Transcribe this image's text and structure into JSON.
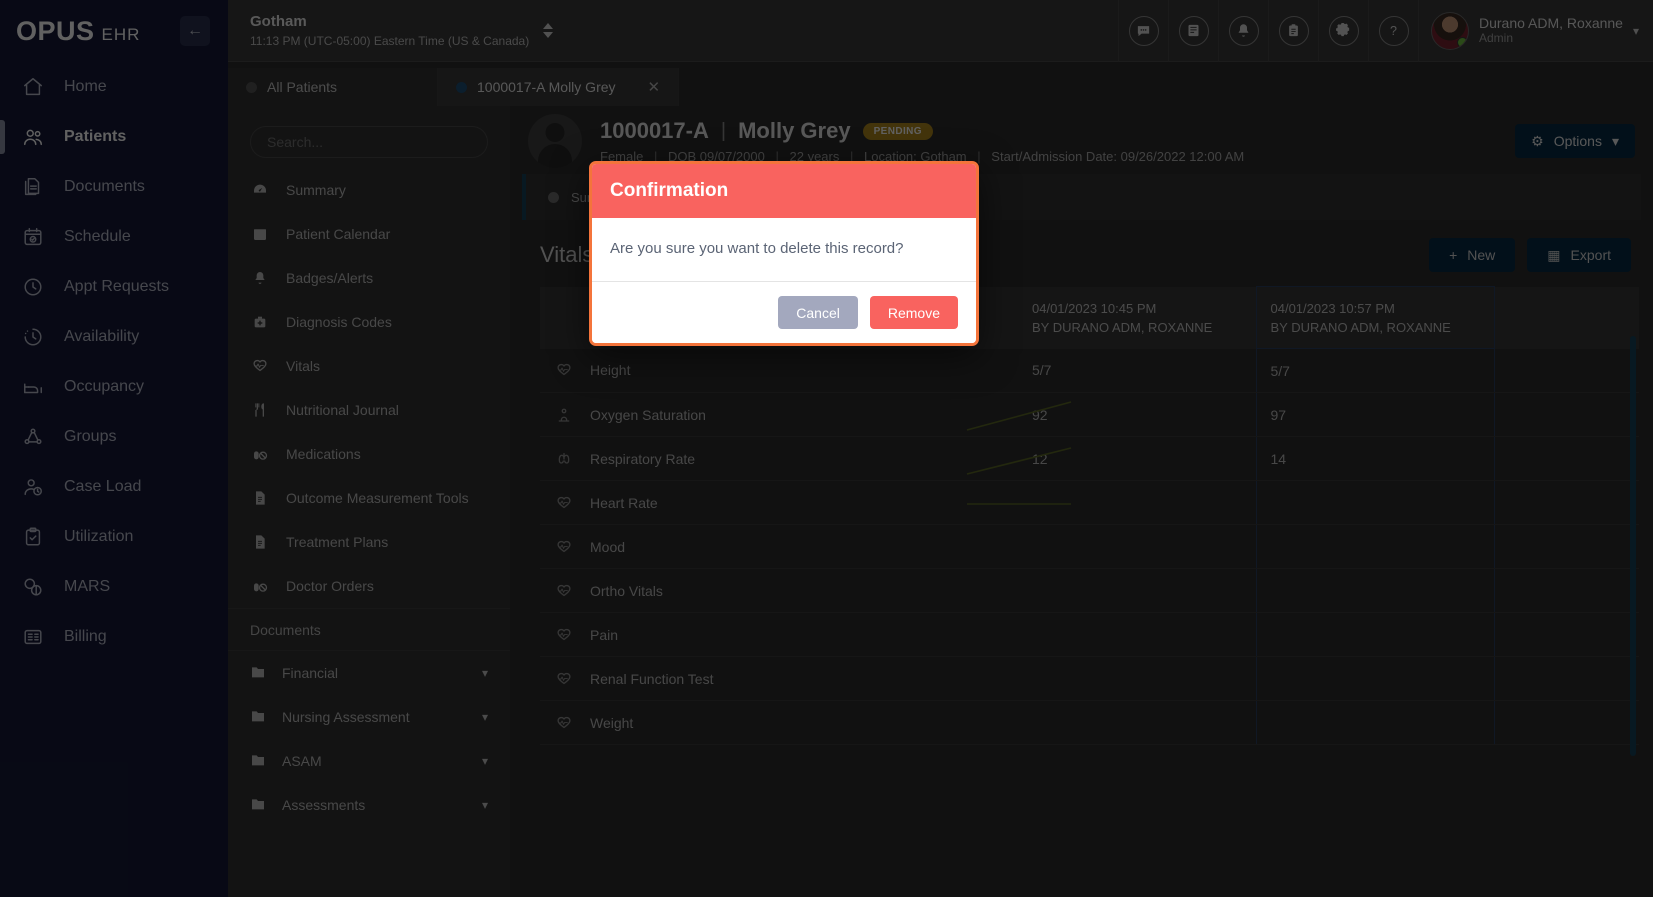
{
  "brand": {
    "logo_main": "OPUS",
    "logo_sub": "EHR",
    "collapse_icon": "arrow-left-icon"
  },
  "rail": {
    "items": [
      {
        "label": "Home",
        "icon": "home-icon",
        "active": false
      },
      {
        "label": "Patients",
        "icon": "users-icon",
        "active": true
      },
      {
        "label": "Documents",
        "icon": "documents-icon",
        "active": false
      },
      {
        "label": "Schedule",
        "icon": "calendar-check-icon",
        "active": false
      },
      {
        "label": "Appt Requests",
        "icon": "clock-icon",
        "active": false
      },
      {
        "label": "Availability",
        "icon": "clock-dashed-icon",
        "active": false
      },
      {
        "label": "Occupancy",
        "icon": "bed-icon",
        "active": false
      },
      {
        "label": "Groups",
        "icon": "group-icon",
        "active": false
      },
      {
        "label": "Case Load",
        "icon": "user-clock-icon",
        "active": false
      },
      {
        "label": "Utilization",
        "icon": "clipboard-check-icon",
        "active": false
      },
      {
        "label": "MARS",
        "icon": "pills-icon",
        "active": false
      },
      {
        "label": "Billing",
        "icon": "billing-list-icon",
        "active": false
      }
    ]
  },
  "topbar": {
    "facility_name": "Gotham",
    "facility_time": "11:13 PM (UTC-05:00) Eastern Time (US & Canada)",
    "icons": [
      {
        "name": "messages-icon",
        "glyph": "●●●"
      },
      {
        "name": "library-icon",
        "glyph": "☰"
      },
      {
        "name": "notifications-bell-icon",
        "glyph": "⌂"
      },
      {
        "name": "tasks-clipboard-icon",
        "glyph": "☰"
      },
      {
        "name": "settings-gear-icon",
        "glyph": "⚙"
      },
      {
        "name": "help-icon",
        "glyph": "?"
      }
    ],
    "user_name": "Durano ADM, Roxanne",
    "user_role": "Admin"
  },
  "tabs": [
    {
      "label": "All Patients",
      "active": false,
      "closable": false
    },
    {
      "label": "1000017-A Molly Grey",
      "active": true,
      "closable": true,
      "close_label": "✕"
    }
  ],
  "chartnav": {
    "search_placeholder": "Search...",
    "items": [
      {
        "label": "Summary",
        "icon": "gauge-icon"
      },
      {
        "label": "Patient Calendar",
        "icon": "calendar-icon"
      },
      {
        "label": "Badges/Alerts",
        "icon": "bell-icon"
      },
      {
        "label": "Diagnosis Codes",
        "icon": "medkit-icon"
      },
      {
        "label": "Vitals",
        "icon": "heart-pulse-icon"
      },
      {
        "label": "Nutritional Journal",
        "icon": "utensils-icon"
      },
      {
        "label": "Medications",
        "icon": "pill-icon"
      },
      {
        "label": "Outcome Measurement Tools",
        "icon": "file-icon"
      },
      {
        "label": "Treatment Plans",
        "icon": "file-icon"
      },
      {
        "label": "Doctor Orders",
        "icon": "pill-icon"
      }
    ],
    "section_label": "Documents",
    "folders": [
      {
        "label": "Financial",
        "icon": "folder-icon",
        "caret": "chevron-down-icon"
      },
      {
        "label": "Nursing Assessment",
        "icon": "folder-icon",
        "caret": "chevron-down-icon"
      },
      {
        "label": "ASAM",
        "icon": "folder-icon",
        "caret": "chevron-down-icon"
      },
      {
        "label": "Assessments",
        "icon": "folder-icon",
        "caret": "chevron-down-icon"
      }
    ]
  },
  "patient": {
    "id": "1000017-A",
    "separator": "|",
    "name": "Molly Grey",
    "status_badge": "PENDING",
    "gender": "Female",
    "dob": "DOB 09/07/2000",
    "age": "22 years",
    "location": "Location: Gotham",
    "admission": "Start/Admission Date: 09/26/2022 12:00 AM",
    "options_label": "Options",
    "options_caret": "▾"
  },
  "summary_strip": {
    "label": "Summary"
  },
  "vitals": {
    "title": "Vitals",
    "new_label": "New",
    "export_label": "Export",
    "columns": [
      {
        "date": "04/01/2023 10:45 PM",
        "by": "BY DURANO ADM, ROXANNE",
        "selected": false
      },
      {
        "date": "04/01/2023 10:57 PM",
        "by": "BY DURANO ADM, ROXANNE",
        "selected": true
      }
    ],
    "rows": [
      {
        "label": "Height",
        "icon": "heart-pulse-icon",
        "values": [
          "5/7",
          "5/7"
        ]
      },
      {
        "label": "Oxygen Saturation",
        "icon": "lungs-o2-icon",
        "values": [
          "92",
          "97"
        ]
      },
      {
        "label": "Respiratory Rate",
        "icon": "lungs-icon",
        "values": [
          "12",
          "14"
        ]
      },
      {
        "label": "Heart Rate",
        "icon": "heart-pulse-icon",
        "values": [
          "",
          ""
        ]
      },
      {
        "label": "Mood",
        "icon": "heart-pulse-icon",
        "values": [
          "",
          ""
        ]
      },
      {
        "label": "Ortho Vitals",
        "icon": "heart-pulse-icon",
        "values": [
          "",
          ""
        ]
      },
      {
        "label": "Pain",
        "icon": "heart-pulse-icon",
        "values": [
          "",
          ""
        ]
      },
      {
        "label": "Renal Function Test",
        "icon": "heart-pulse-icon",
        "values": [
          "",
          ""
        ]
      },
      {
        "label": "Weight",
        "icon": "heart-pulse-icon",
        "values": [
          "",
          ""
        ]
      }
    ]
  },
  "modal": {
    "title": "Confirmation",
    "message": "Are you sure you want to delete this record?",
    "cancel_label": "Cancel",
    "remove_label": "Remove"
  },
  "colors": {
    "rail_bg": "#151a38",
    "modal_header": "#f9635f",
    "modal_outline": "#f4743b",
    "cancel_btn": "#a3a8be",
    "accent_button": "#062b45",
    "badge": "#b08a1e",
    "selected_col_border": "#2c3f63",
    "scrollbar": "#16425b"
  }
}
